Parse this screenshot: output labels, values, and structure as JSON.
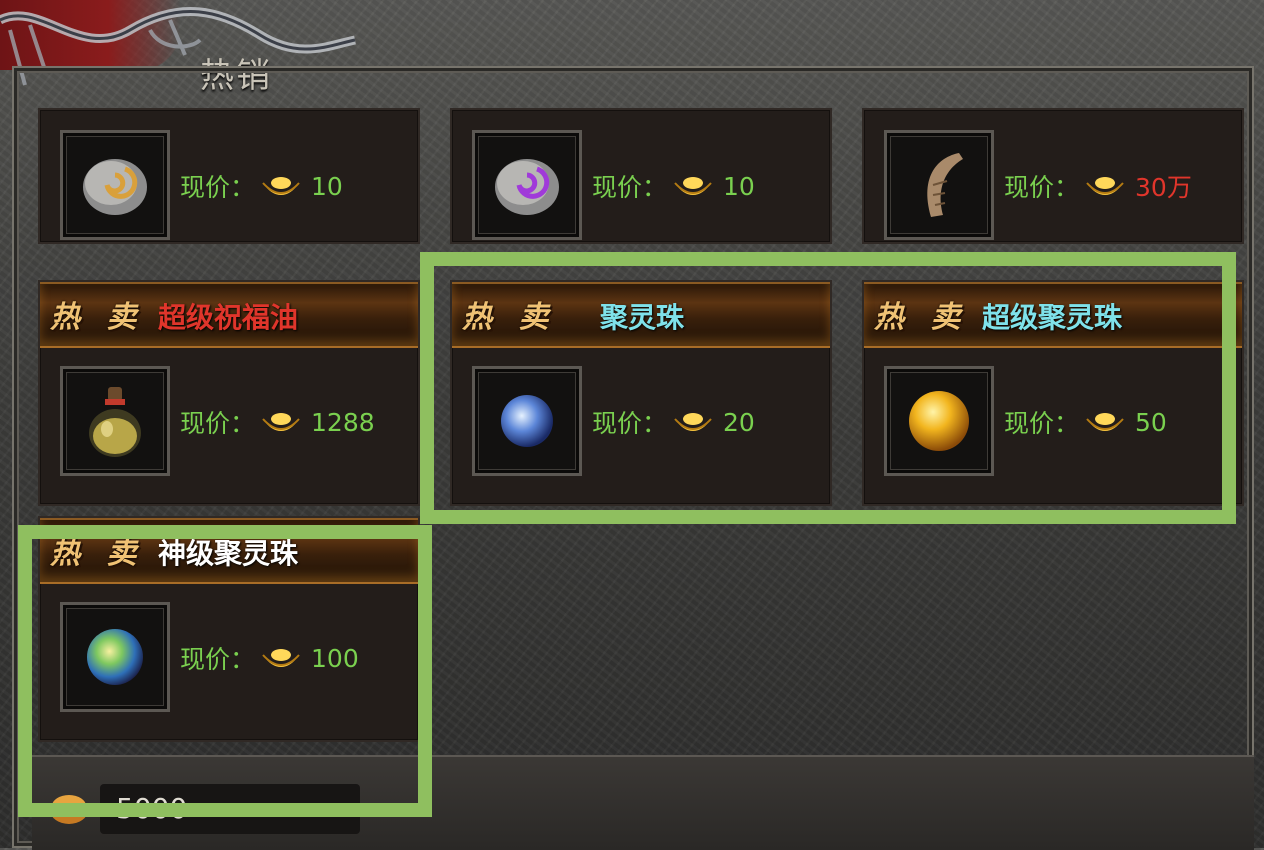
{
  "window": {
    "title": "热销"
  },
  "price_label": "现价：",
  "hot_badge": "热 卖",
  "items": [
    {
      "name": "",
      "price": "10",
      "price_color": "#7ad04f",
      "icon": "gold-rune-stone-icon"
    },
    {
      "name": "",
      "price": "10",
      "price_color": "#7ad04f",
      "icon": "purple-rune-stone-icon"
    },
    {
      "name": "",
      "price": "30万",
      "price_color": "#e0352b",
      "icon": "horn-icon"
    },
    {
      "name": "超级祝福油",
      "name_color": "#e0352b",
      "price": "1288",
      "icon": "potion-bottle-icon"
    },
    {
      "name": "聚灵珠",
      "name_color": "#7fe2ea",
      "price": "20",
      "icon": "blue-orb-icon"
    },
    {
      "name": "超级聚灵珠",
      "name_color": "#7fe2ea",
      "price": "50",
      "icon": "golden-orb-icon"
    },
    {
      "name": "神级聚灵珠",
      "name_color": "#ffffff",
      "price": "100",
      "icon": "rainbow-orb-icon"
    }
  ],
  "currency": {
    "amount": "5000",
    "icon": "gold-coin-icon"
  },
  "highlight_color": "#8fbf5f"
}
